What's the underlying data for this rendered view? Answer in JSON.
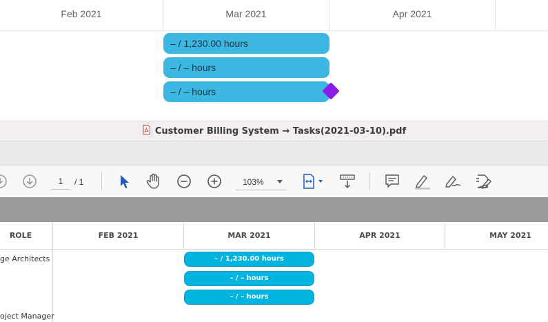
{
  "gantt": {
    "months": [
      "Feb 2021",
      "Mar 2021",
      "Apr 2021"
    ],
    "bars": [
      "– / 1,230.00 hours",
      "– / – hours",
      "– / – hours"
    ],
    "milestone_color": "#8a1ee8",
    "bar_color": "#3cb7e1"
  },
  "pdf_viewer": {
    "file_title": "Customer Billing System → Tasks(2021-03-10).pdf",
    "page_current": "1",
    "page_total": "/ 1",
    "zoom": "103%",
    "icons": [
      "rotate-icon",
      "download-icon",
      "select-pointer-icon",
      "hand-pan-icon",
      "zoom-out-icon",
      "zoom-in-icon",
      "fit-page-icon",
      "download-tray-icon",
      "comment-icon",
      "highlight-pen-icon",
      "signature-icon",
      "edit-document-icon"
    ]
  },
  "pdf_content": {
    "headers": [
      "ROLE",
      "FEB 2021",
      "MAR 2021",
      "APR 2021",
      "MAY 2021"
    ],
    "roles": [
      "ge Architects",
      "oject Manager"
    ],
    "bars": [
      "– / 1,230.00 hours",
      "– / – hours",
      "– / – hours"
    ],
    "bar_color": "#00b4e2"
  }
}
